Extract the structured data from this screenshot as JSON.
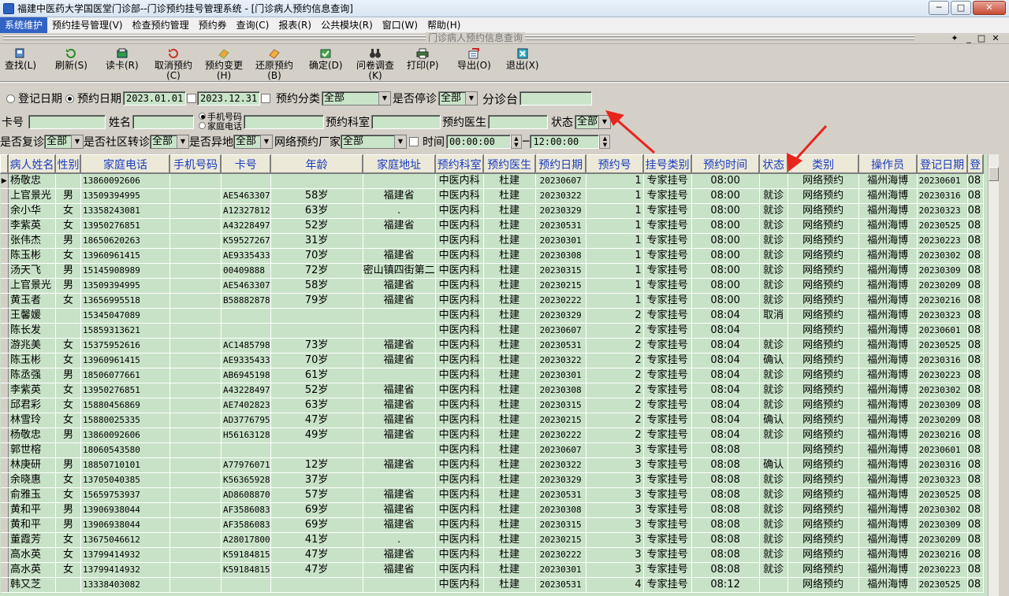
{
  "window": {
    "title": "福建中医药大学国医堂门诊部--门诊预约挂号管理系统 - [门诊病人预约信息查询]",
    "minimize": "─",
    "maximize": "□",
    "close": "✕"
  },
  "menu": [
    "系统维护",
    "预约挂号管理(V)",
    "检查预约管理",
    "预约券",
    "查询(C)",
    "报表(R)",
    "公共模块(R)",
    "窗口(W)",
    "帮助(H)"
  ],
  "mdi": {
    "caption": "门诊病人预约信息查询",
    "pin": "✦",
    "min": "_",
    "max": "□",
    "close": "✕"
  },
  "toolbar": [
    {
      "label": "查找(L)",
      "icon": "find-icon"
    },
    {
      "label": "刷新(S)",
      "icon": "refresh-icon"
    },
    {
      "label": "读卡(R)",
      "icon": "card-reader-icon"
    },
    {
      "label": "取消预约\n(C)",
      "icon": "cancel-icon"
    },
    {
      "label": "预约变更\n(H)",
      "icon": "change-icon"
    },
    {
      "label": "还原预约\n(B)",
      "icon": "restore-icon"
    },
    {
      "label": "确定(D)",
      "icon": "confirm-icon"
    },
    {
      "label": "问卷调查\n(K)",
      "icon": "binoculars-icon"
    },
    {
      "label": "打印(P)",
      "icon": "printer-icon"
    },
    {
      "label": "导出(O)",
      "icon": "export-icon"
    },
    {
      "label": "退出(X)",
      "icon": "exit-icon"
    }
  ],
  "filters": {
    "reg_date_label": "登记日期",
    "appt_date_label": "预约日期",
    "date_from": "2023.01.01",
    "date_to": "2023.12.31",
    "category_label": "预约分类",
    "category_value": "全部",
    "suspend_label": "是否停诊",
    "suspend_value": "全部",
    "branch_label": "分诊台",
    "branch_value": "",
    "card_label": "卡号",
    "card_value": "",
    "name_label": "姓名",
    "name_value": "",
    "mobile_label": "手机号码",
    "home_phone_label": "家庭电话",
    "phone_value": "",
    "dept_label": "预约科室",
    "dept_value": "",
    "doctor_label": "预约医生",
    "doctor_value": "",
    "status_label": "状态",
    "status_value": "全部",
    "revisit_label": "是否复诊",
    "revisit_value": "全部",
    "community_label": "是否社区转诊",
    "community_value": "全部",
    "remote_label": "是否异地",
    "remote_value": "全部",
    "vendor_label": "网络预约厂家",
    "vendor_value": "全部",
    "time_label": "时间",
    "time_from": "00:00:00",
    "time_to": "12:00:00"
  },
  "grid": {
    "columns": [
      "病人姓名",
      "性别",
      "家庭电话",
      "手机号码",
      "卡号",
      "年龄",
      "家庭地址",
      "预约科室",
      "预约医生",
      "预约日期",
      "预约号",
      "挂号类别",
      "预约时间",
      "状态",
      "类别",
      "操作员",
      "登记日期",
      "登"
    ],
    "rows": [
      [
        "杨敬忠",
        "",
        "13860092606",
        "",
        "",
        "",
        "",
        "中医内科",
        "杜建",
        "20230607",
        "1",
        "专家挂号",
        "08:00",
        "",
        "网络预约",
        "福州海博",
        "20230601",
        "08"
      ],
      [
        "上官景光",
        "男",
        "13509394995",
        "",
        "AE5463307",
        "58岁",
        "福建省",
        "中医内科",
        "杜建",
        "20230322",
        "1",
        "专家挂号",
        "08:00",
        "就诊",
        "网络预约",
        "福州海博",
        "20230316",
        "08"
      ],
      [
        "余小华",
        "女",
        "13358243081",
        "",
        "A12327812",
        "63岁",
        ".",
        "中医内科",
        "杜建",
        "20230329",
        "1",
        "专家挂号",
        "08:00",
        "就诊",
        "网络预约",
        "福州海博",
        "20230323",
        "08"
      ],
      [
        "李紫英",
        "女",
        "13950276851",
        "",
        "A43228497",
        "52岁",
        "福建省",
        "中医内科",
        "杜建",
        "20230531",
        "1",
        "专家挂号",
        "08:00",
        "就诊",
        "网络预约",
        "福州海博",
        "20230525",
        "08"
      ],
      [
        "张伟杰",
        "男",
        "18650620263",
        "",
        "K59527267",
        "31岁",
        "",
        "中医内科",
        "杜建",
        "20230301",
        "1",
        "专家挂号",
        "08:00",
        "就诊",
        "网络预约",
        "福州海博",
        "20230223",
        "08"
      ],
      [
        "陈玉彬",
        "女",
        "13960961415",
        "",
        "AE9335433",
        "70岁",
        "福建省",
        "中医内科",
        "杜建",
        "20230308",
        "1",
        "专家挂号",
        "08:00",
        "就诊",
        "网络预约",
        "福州海博",
        "20230302",
        "08"
      ],
      [
        "汤天飞",
        "男",
        "15145908989",
        "",
        "00409888",
        "72岁",
        "密山镇四街第二",
        "中医内科",
        "杜建",
        "20230315",
        "1",
        "专家挂号",
        "08:00",
        "就诊",
        "网络预约",
        "福州海博",
        "20230309",
        "08"
      ],
      [
        "上官景光",
        "男",
        "13509394995",
        "",
        "AE5463307",
        "58岁",
        "福建省",
        "中医内科",
        "杜建",
        "20230215",
        "1",
        "专家挂号",
        "08:00",
        "就诊",
        "网络预约",
        "福州海博",
        "20230209",
        "08"
      ],
      [
        "黄玉者",
        "女",
        "13656995518",
        "",
        "B58882878",
        "79岁",
        "福建省",
        "中医内科",
        "杜建",
        "20230222",
        "1",
        "专家挂号",
        "08:00",
        "就诊",
        "网络预约",
        "福州海博",
        "20230216",
        "08"
      ],
      [
        "王馨媛",
        "",
        "15345047089",
        "",
        "",
        "",
        "",
        "中医内科",
        "杜建",
        "20230329",
        "2",
        "专家挂号",
        "08:04",
        "取消",
        "网络预约",
        "福州海博",
        "20230323",
        "08"
      ],
      [
        "陈长发",
        "",
        "15859313621",
        "",
        "",
        "",
        "",
        "中医内科",
        "杜建",
        "20230607",
        "2",
        "专家挂号",
        "08:04",
        "",
        "网络预约",
        "福州海博",
        "20230601",
        "08"
      ],
      [
        "游兆美",
        "女",
        "15375952616",
        "",
        "AC1485798",
        "73岁",
        "福建省",
        "中医内科",
        "杜建",
        "20230531",
        "2",
        "专家挂号",
        "08:04",
        "就诊",
        "网络预约",
        "福州海博",
        "20230525",
        "08"
      ],
      [
        "陈玉彬",
        "女",
        "13960961415",
        "",
        "AE9335433",
        "70岁",
        "福建省",
        "中医内科",
        "杜建",
        "20230322",
        "2",
        "专家挂号",
        "08:04",
        "确认",
        "网络预约",
        "福州海博",
        "20230316",
        "08"
      ],
      [
        "陈丞强",
        "男",
        "18506077661",
        "",
        "AB6945198",
        "61岁",
        "",
        "中医内科",
        "杜建",
        "20230301",
        "2",
        "专家挂号",
        "08:04",
        "就诊",
        "网络预约",
        "福州海博",
        "20230223",
        "08"
      ],
      [
        "李紫英",
        "女",
        "13950276851",
        "",
        "A43228497",
        "52岁",
        "福建省",
        "中医内科",
        "杜建",
        "20230308",
        "2",
        "专家挂号",
        "08:04",
        "就诊",
        "网络预约",
        "福州海博",
        "20230302",
        "08"
      ],
      [
        "邱君彩",
        "女",
        "15880456869",
        "",
        "AE7402823",
        "63岁",
        "福建省",
        "中医内科",
        "杜建",
        "20230315",
        "2",
        "专家挂号",
        "08:04",
        "就诊",
        "网络预约",
        "福州海博",
        "20230309",
        "08"
      ],
      [
        "林雪玲",
        "女",
        "15880025335",
        "",
        "AD3776795",
        "47岁",
        "福建省",
        "中医内科",
        "杜建",
        "20230215",
        "2",
        "专家挂号",
        "08:04",
        "确认",
        "网络预约",
        "福州海博",
        "20230209",
        "08"
      ],
      [
        "杨敬忠",
        "男",
        "13860092606",
        "",
        "H56163128",
        "49岁",
        "福建省",
        "中医内科",
        "杜建",
        "20230222",
        "2",
        "专家挂号",
        "08:04",
        "就诊",
        "网络预约",
        "福州海博",
        "20230216",
        "08"
      ],
      [
        "郭世榕",
        "",
        "18060543580",
        "",
        "",
        "",
        "",
        "中医内科",
        "杜建",
        "20230607",
        "3",
        "专家挂号",
        "08:08",
        "",
        "网络预约",
        "福州海博",
        "20230601",
        "08"
      ],
      [
        "林庚研",
        "男",
        "18850710101",
        "",
        "A77976071",
        "12岁",
        "福建省",
        "中医内科",
        "杜建",
        "20230322",
        "3",
        "专家挂号",
        "08:08",
        "确认",
        "网络预约",
        "福州海博",
        "20230316",
        "08"
      ],
      [
        "余晓惠",
        "女",
        "13705040385",
        "",
        "K56365928",
        "37岁",
        "",
        "中医内科",
        "杜建",
        "20230329",
        "3",
        "专家挂号",
        "08:08",
        "就诊",
        "网络预约",
        "福州海博",
        "20230323",
        "08"
      ],
      [
        "俞雅玉",
        "女",
        "15659753937",
        "",
        "AD8608870",
        "57岁",
        "福建省",
        "中医内科",
        "杜建",
        "20230531",
        "3",
        "专家挂号",
        "08:08",
        "就诊",
        "网络预约",
        "福州海博",
        "20230525",
        "08"
      ],
      [
        "黄和平",
        "男",
        "13906938044",
        "",
        "AF3586083",
        "69岁",
        "福建省",
        "中医内科",
        "杜建",
        "20230308",
        "3",
        "专家挂号",
        "08:08",
        "就诊",
        "网络预约",
        "福州海博",
        "20230302",
        "08"
      ],
      [
        "黄和平",
        "男",
        "13906938044",
        "",
        "AF3586083",
        "69岁",
        "福建省",
        "中医内科",
        "杜建",
        "20230315",
        "3",
        "专家挂号",
        "08:08",
        "就诊",
        "网络预约",
        "福州海博",
        "20230309",
        "08"
      ],
      [
        "董霞芳",
        "女",
        "13675046612",
        "",
        "A28017800",
        "41岁",
        ".",
        "中医内科",
        "杜建",
        "20230215",
        "3",
        "专家挂号",
        "08:08",
        "就诊",
        "网络预约",
        "福州海博",
        "20230209",
        "08"
      ],
      [
        "高水英",
        "女",
        "13799414932",
        "",
        "K59184815",
        "47岁",
        "福建省",
        "中医内科",
        "杜建",
        "20230222",
        "3",
        "专家挂号",
        "08:08",
        "就诊",
        "网络预约",
        "福州海博",
        "20230216",
        "08"
      ],
      [
        "高水英",
        "女",
        "13799414932",
        "",
        "K59184815",
        "47岁",
        "福建省",
        "中医内科",
        "杜建",
        "20230301",
        "3",
        "专家挂号",
        "08:08",
        "就诊",
        "网络预约",
        "福州海博",
        "20230223",
        "08"
      ],
      [
        "韩又芝",
        "",
        "13338403082",
        "",
        "",
        "",
        "",
        "中医内科",
        "杜建",
        "20230531",
        "4",
        "专家挂号",
        "08:12",
        "",
        "网络预约",
        "福州海博",
        "20230525",
        "08"
      ]
    ]
  },
  "colors": {
    "grid_bg": "#c8e2c8",
    "header_text": "#1a3cc0",
    "arrow": "#e8241c",
    "menu_active": "#3163c5"
  }
}
